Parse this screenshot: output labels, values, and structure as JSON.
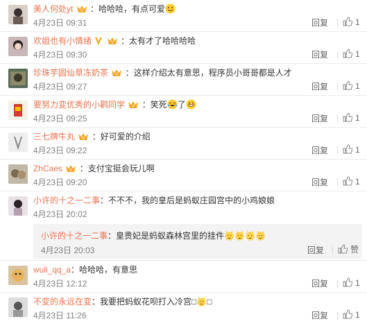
{
  "comments": [
    {
      "nick": "美人何处yt",
      "text": "：哈哈哈，有点可爱",
      "date": "4月23日 09:31",
      "reply": "回复",
      "like": "1",
      "emoji": "smile",
      "vbadge": false
    },
    {
      "nick": "欢姐也有小情绪",
      "text": "：太有才了哈哈哈哈",
      "date": "4月23日 09:30",
      "reply": "回复",
      "like": "1",
      "emoji": "",
      "vbadge": true
    },
    {
      "nick": "珍珠芋圆仙草冻奶茶",
      "text": "：这样介绍太有意思，程序员小哥哥都是人才",
      "date": "4月23日 09:27",
      "reply": "回复",
      "like": "1",
      "emoji": "",
      "vbadge": false
    },
    {
      "nick": "要努力变优秀的小鹳同学",
      "text": "：笑死",
      "text2": "了",
      "date": "4月23日 09:25",
      "reply": "回复",
      "like": "1",
      "emoji": "laugh-cry",
      "vbadge": false
    },
    {
      "nick": "三七牌牛丸",
      "text": "：好可爱的介绍",
      "date": "4月23日 09:22",
      "reply": "回复",
      "like": "1",
      "emoji": "",
      "vbadge": false
    },
    {
      "nick": "ZhCaes",
      "text": "：支付宝挺会玩儿啊",
      "date": "4月23日 09:20",
      "reply": "回复",
      "like": "1",
      "emoji": "",
      "vbadge": false
    },
    {
      "nick": "小许的十之一二事",
      "text": "：不不不，我的皇后是蚂蚁庄园宫中的小鸡娘娘",
      "date": "4月23日 20:02",
      "reply": "",
      "like": "",
      "emoji": "",
      "vbadge": false
    },
    {
      "nick": "wuli_qq_a",
      "text": "：哈哈哈，有意思",
      "date": "4月23日 12:12",
      "reply": "回复",
      "like": "1",
      "emoji": "",
      "vbadge": false
    },
    {
      "nick": "不变的永远在变",
      "text": "：我要把蚂蚁花呗打入冷宫",
      "text2": "",
      "date": "4月23日 11:26",
      "reply": "回复",
      "like": "1",
      "emoji": "cat",
      "vbadge": false
    }
  ],
  "nested": {
    "nick": "小许的十之一二事",
    "text": "：皇贵妃是蚂蚁森林宫里的挂件",
    "date": "4月23日 20:03",
    "reply": "回复",
    "like": "赞"
  },
  "colors": {
    "nick": "#eb7350",
    "badge": "#f5a623",
    "meta": "#808080"
  }
}
